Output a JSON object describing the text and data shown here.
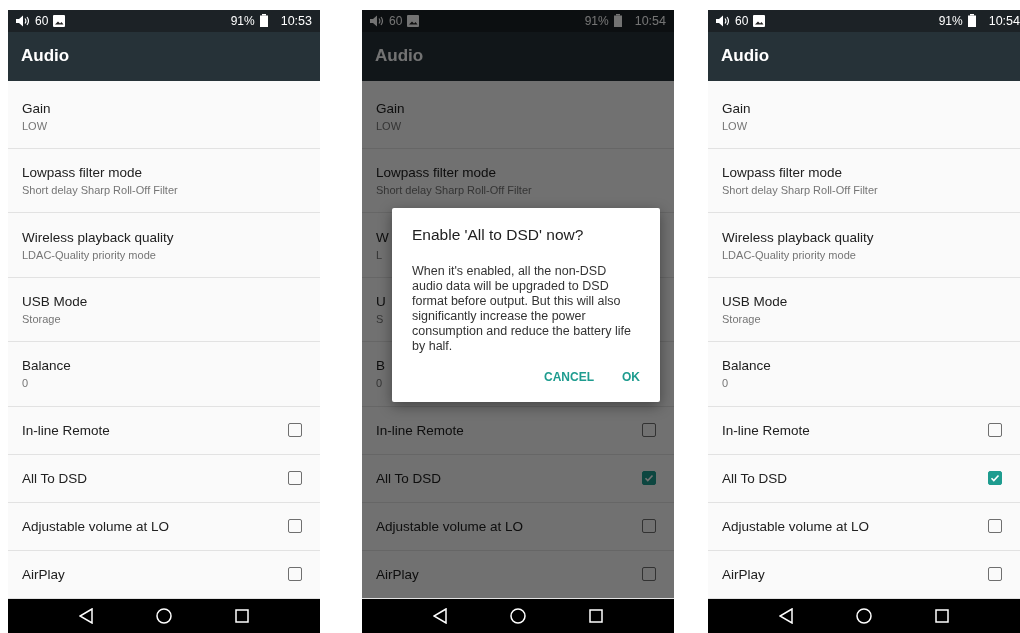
{
  "screens": [
    {
      "status_bar": {
        "volume": "60",
        "battery": "91%",
        "time": "10:53"
      },
      "title": "Audio",
      "settings": [
        {
          "kind": "detail",
          "title": "Gain",
          "summary": "LOW"
        },
        {
          "kind": "detail",
          "title": "Lowpass filter mode",
          "summary": "Short delay Sharp Roll-Off Filter"
        },
        {
          "kind": "detail",
          "title": "Wireless playback quality",
          "summary": "LDAC-Quality priority mode"
        },
        {
          "kind": "detail",
          "title": "USB Mode",
          "summary": "Storage"
        },
        {
          "kind": "detail",
          "title": "Balance",
          "summary": "0"
        },
        {
          "kind": "checkbox",
          "title": "In-line Remote",
          "checked": false
        },
        {
          "kind": "checkbox",
          "title": "All To DSD",
          "checked": false
        },
        {
          "kind": "checkbox",
          "title": "Adjustable volume at LO",
          "checked": false
        },
        {
          "kind": "checkbox",
          "title": "AirPlay",
          "checked": false
        }
      ]
    },
    {
      "status_bar": {
        "volume": "60",
        "battery": "91%",
        "time": "10:54"
      },
      "title": "Audio",
      "settings": [
        {
          "kind": "detail",
          "title": "Gain",
          "summary": "LOW"
        },
        {
          "kind": "detail",
          "title": "Lowpass filter mode",
          "summary": "Short delay Sharp Roll-Off Filter"
        },
        {
          "kind": "detail",
          "title": "W",
          "summary": "L"
        },
        {
          "kind": "detail",
          "title": "U",
          "summary": "S"
        },
        {
          "kind": "detail",
          "title": "B",
          "summary": "0"
        },
        {
          "kind": "checkbox",
          "title": "In-line Remote",
          "checked": false
        },
        {
          "kind": "checkbox",
          "title": "All To DSD",
          "checked": true
        },
        {
          "kind": "checkbox",
          "title": "Adjustable volume at LO",
          "checked": false
        },
        {
          "kind": "checkbox",
          "title": "AirPlay",
          "checked": false
        }
      ],
      "dialog": {
        "title": "Enable 'All to DSD' now?",
        "message": "When it's enabled, all the non-DSD audio data will be upgraded to DSD format before output. But this will also significantly increase the power consumption and reduce the battery life by half.",
        "buttons": [
          "CANCEL",
          "OK"
        ]
      }
    },
    {
      "status_bar": {
        "volume": "60",
        "battery": "91%",
        "time": "10:54"
      },
      "title": "Audio",
      "settings": [
        {
          "kind": "detail",
          "title": "Gain",
          "summary": "LOW"
        },
        {
          "kind": "detail",
          "title": "Lowpass filter mode",
          "summary": "Short delay Sharp Roll-Off Filter"
        },
        {
          "kind": "detail",
          "title": "Wireless playback quality",
          "summary": "LDAC-Quality priority mode"
        },
        {
          "kind": "detail",
          "title": "USB Mode",
          "summary": "Storage"
        },
        {
          "kind": "detail",
          "title": "Balance",
          "summary": "0"
        },
        {
          "kind": "checkbox",
          "title": "In-line Remote",
          "checked": false
        },
        {
          "kind": "checkbox",
          "title": "All To DSD",
          "checked": true
        },
        {
          "kind": "checkbox",
          "title": "Adjustable volume at LO",
          "checked": false
        },
        {
          "kind": "checkbox",
          "title": "AirPlay",
          "checked": false
        }
      ]
    }
  ]
}
